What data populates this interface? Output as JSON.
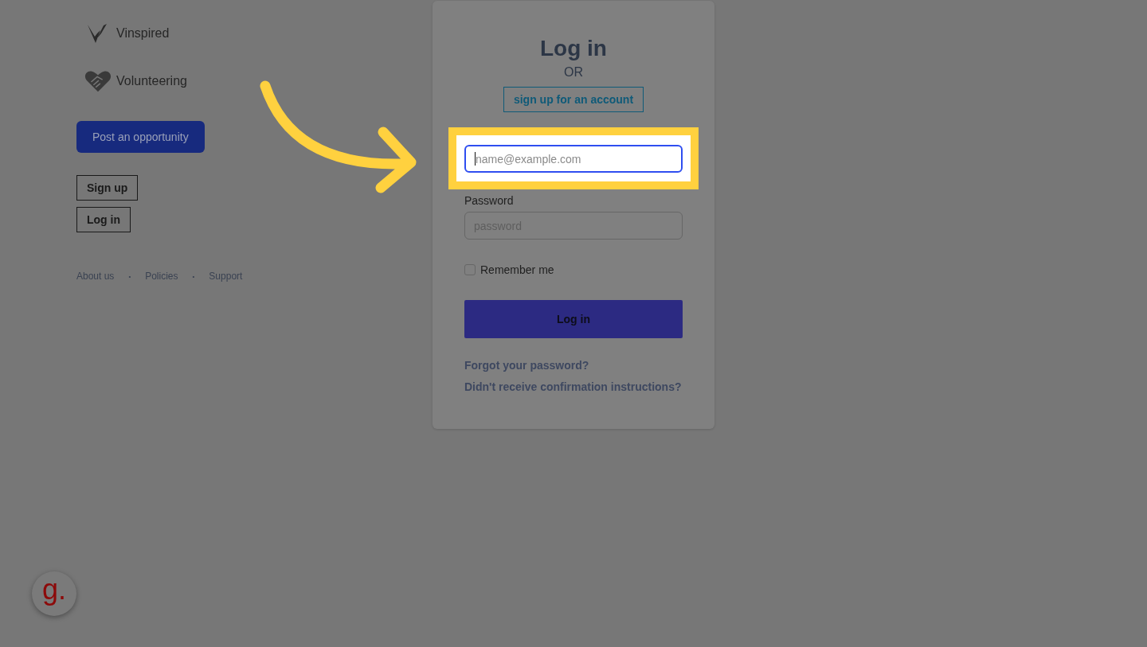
{
  "brand": {
    "name": "Vinspired"
  },
  "section": {
    "name": "Volunteering"
  },
  "post_button": "Post an opportunity",
  "account_buttons": [
    "Sign up",
    "Log in"
  ],
  "footer": [
    {
      "kind": "link",
      "text": "About us"
    },
    {
      "kind": "separator",
      "text": "•"
    },
    {
      "kind": "link",
      "text": "Policies"
    },
    {
      "kind": "separator",
      "text": "•"
    },
    {
      "kind": "link",
      "text": "Support"
    }
  ],
  "login": {
    "title": "Log in",
    "or_text": "OR",
    "signup_button": "sign up for an account",
    "email": {
      "placeholder": "name@example.com",
      "focused": true
    },
    "password": {
      "label": "Password",
      "placeholder": "password"
    },
    "remember": {
      "label": "Remember me",
      "checked": false
    },
    "submit": "Log in",
    "links": [
      "Forgot your password?",
      "Didn't receive confirmation instructions?"
    ]
  },
  "help_widget": {
    "logo": "g."
  }
}
